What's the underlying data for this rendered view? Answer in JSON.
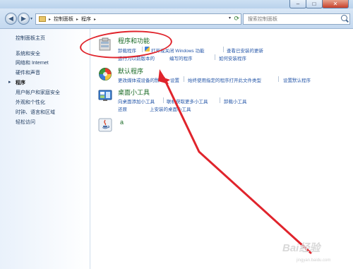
{
  "window": {
    "controls": {
      "minimize": "–",
      "maximize": "□",
      "close": "✕"
    }
  },
  "nav": {
    "back_icon": "back-arrow-icon",
    "forward_icon": "forward-arrow-icon",
    "history_dropdown": "▾",
    "breadcrumbs": [
      "控制面板",
      "程序"
    ],
    "breadcrumb_separator": "▸",
    "address_dropdown": "▾",
    "refresh": "⟳",
    "search_placeholder": "搜索控制面板"
  },
  "sidebar": {
    "items": [
      {
        "label": "控制面板主页"
      },
      {
        "label": "系统和安全"
      },
      {
        "label": "网络和 Internet"
      },
      {
        "label": "硬件和声音"
      },
      {
        "label": "程序",
        "current": true
      },
      {
        "label": "用户帐户和家庭安全"
      },
      {
        "label": "外观和个性化"
      },
      {
        "label": "时钟、语言和区域"
      },
      {
        "label": "轻松访问"
      }
    ],
    "bullet": "▸"
  },
  "main": {
    "groups": [
      {
        "title": "程序和功能",
        "icon": "programs-features-icon",
        "links_row1": [
          "卸载程序",
          "打开或关闭 Windows 功能",
          "查看已安装的更新"
        ],
        "links_row2": [
          "运行为以前版本的",
          "编写的程序",
          "如何安装程序"
        ]
      },
      {
        "title": "默认程序",
        "icon": "default-programs-icon",
        "links_row1": [
          "更改媒体或设备的默",
          "设置",
          "始终使用指定的程序打开此文件类型",
          "设置默认程序"
        ]
      },
      {
        "title": "桌面小工具",
        "icon": "desktop-gadgets-icon",
        "links_row1": [
          "向桌面添加小工具",
          "联机获取更多小工具",
          "卸载小工具"
        ],
        "links_row2": [
          "还原",
          "上安装的桌面小工具"
        ]
      },
      {
        "title": "a",
        "icon": "java-icon"
      }
    ]
  },
  "annotation": {
    "color": "#e0242c"
  },
  "watermark": {
    "text": "Bai经验",
    "url": "jingyan.baidu.com"
  }
}
